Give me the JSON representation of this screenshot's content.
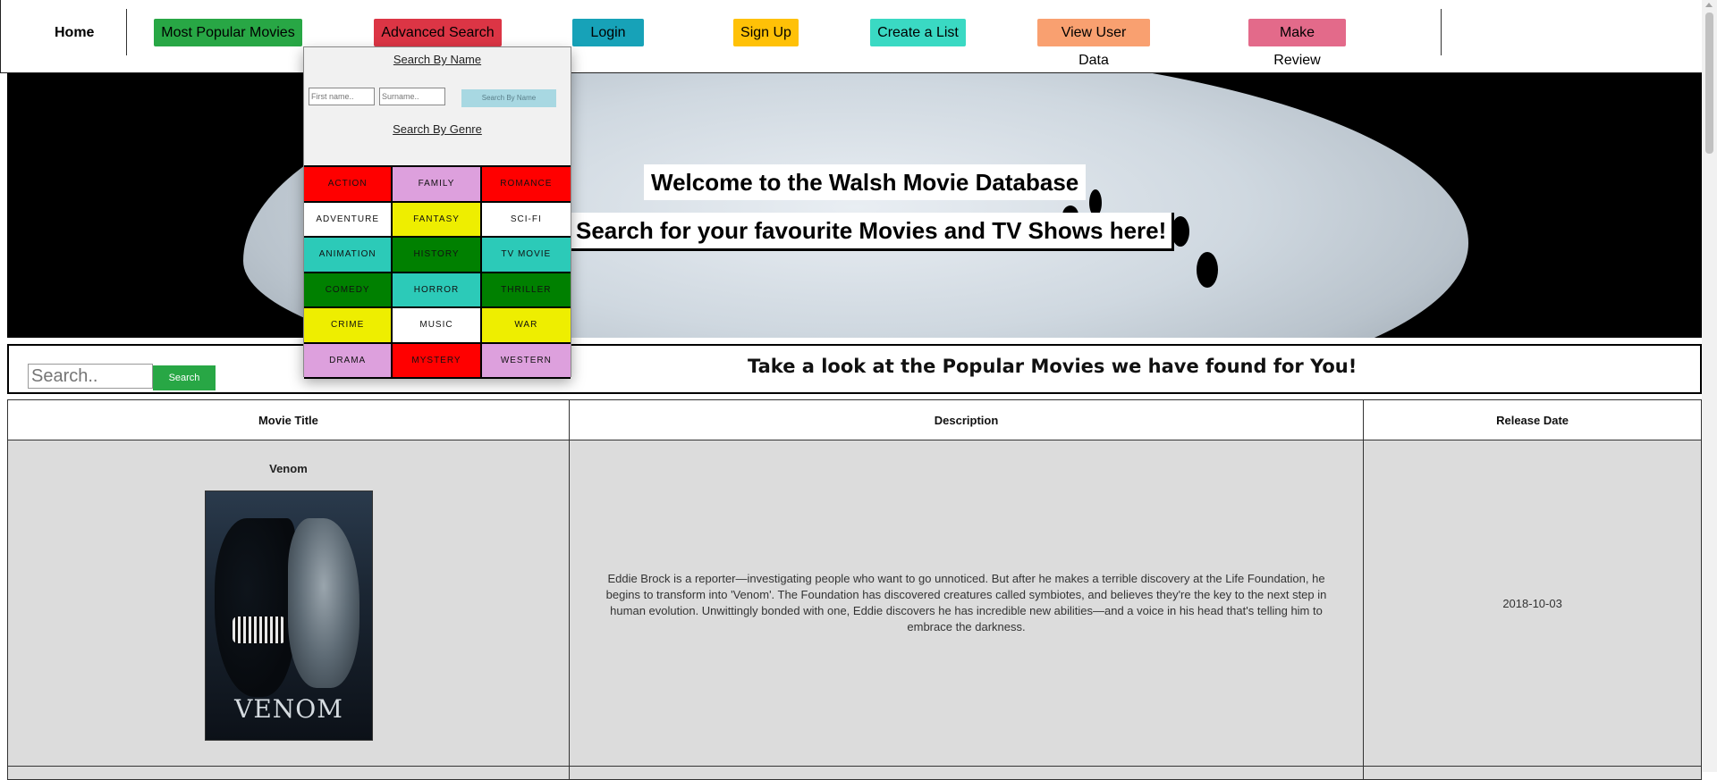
{
  "nav": {
    "home": "Home",
    "popular": "Most Popular Movies",
    "advanced": "Advanced Search",
    "login": "Login",
    "signup": "Sign Up",
    "create_list": "Create a List",
    "user_data": "View User Data",
    "review": "Make Review",
    "colors": {
      "popular": "#28a745",
      "advanced": "#dc3545",
      "login": "#17a2b8",
      "signup": "#ffc107",
      "create_list": "#3ad9c3",
      "user_data": "#f9a070",
      "review": "#e36a8a"
    }
  },
  "dropdown": {
    "search_by_name": "Search By Name",
    "first_placeholder": "First name..",
    "surname_placeholder": "Surname..",
    "name_button": "Search By Name",
    "search_by_genre": "Search By Genre",
    "genres": [
      {
        "label": "ACTION",
        "color": "red"
      },
      {
        "label": "FAMILY",
        "color": "pink"
      },
      {
        "label": "ROMANCE",
        "color": "red"
      },
      {
        "label": "ADVENTURE",
        "color": "white"
      },
      {
        "label": "FANTASY",
        "color": "yellow"
      },
      {
        "label": "SCI-FI",
        "color": "white"
      },
      {
        "label": "ANIMATION",
        "color": "teal"
      },
      {
        "label": "HISTORY",
        "color": "green"
      },
      {
        "label": "TV MOVIE",
        "color": "teal"
      },
      {
        "label": "COMEDY",
        "color": "green"
      },
      {
        "label": "HORROR",
        "color": "teal"
      },
      {
        "label": "THRILLER",
        "color": "green"
      },
      {
        "label": "CRIME",
        "color": "yellow"
      },
      {
        "label": "MUSIC",
        "color": "white"
      },
      {
        "label": "WAR",
        "color": "yellow"
      },
      {
        "label": "DRAMA",
        "color": "pink"
      },
      {
        "label": "MYSTERY",
        "color": "red"
      },
      {
        "label": "WESTERN",
        "color": "pink"
      }
    ]
  },
  "hero": {
    "title": "Welcome to the Walsh Movie Database",
    "subtitle": "Search for your favourite Movies and TV Shows here!"
  },
  "search": {
    "placeholder": "Search..",
    "button": "Search",
    "heading": "Take a look at the Popular Movies we have found for You!"
  },
  "table": {
    "headers": [
      "Movie Title",
      "Description",
      "Release Date"
    ],
    "rows": [
      {
        "title": "Venom",
        "poster_text": "VENOM",
        "description": "Eddie Brock is a reporter—investigating people who want to go unnoticed. But after he makes a terrible discovery at the Life Foundation, he begins to transform into 'Venom'. The Foundation has discovered creatures called symbiotes, and believes they're the key to the next step in human evolution. Unwittingly bonded with one, Eddie discovers he has incredible new abilities—and a voice in his head that's telling him to embrace the darkness.",
        "release_date": "2018-10-03"
      }
    ]
  }
}
